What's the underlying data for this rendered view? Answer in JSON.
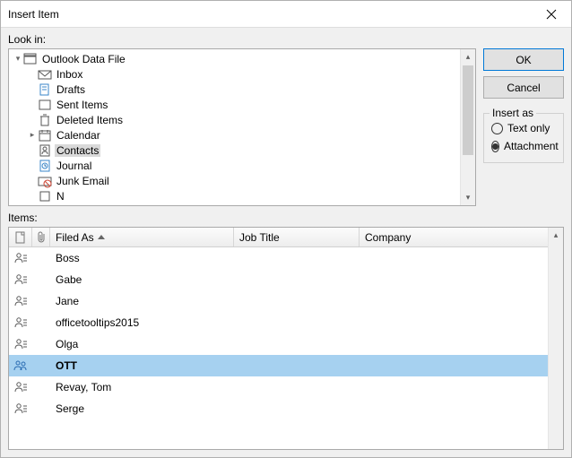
{
  "window_title": "Insert Item",
  "look_in_label": "Look in:",
  "items_label": "Items:",
  "buttons": {
    "ok": "OK",
    "cancel": "Cancel"
  },
  "insert_as": {
    "legend": "Insert as",
    "text_only": "Text only",
    "attachment": "Attachment",
    "selected": "attachment"
  },
  "tree": {
    "root": "Outlook Data File",
    "children": [
      "Inbox",
      "Drafts",
      "Sent Items",
      "Deleted Items",
      "Calendar",
      "Contacts",
      "Journal",
      "Junk Email",
      "Notes"
    ],
    "selected": "Contacts"
  },
  "columns": {
    "filed_as": "Filed As",
    "job_title": "Job Title",
    "company": "Company"
  },
  "items": [
    {
      "filed_as": "Boss",
      "job_title": "",
      "company": "",
      "type": "contact"
    },
    {
      "filed_as": "Gabe",
      "job_title": "",
      "company": "",
      "type": "contact"
    },
    {
      "filed_as": "Jane",
      "job_title": "",
      "company": "",
      "type": "contact"
    },
    {
      "filed_as": "officetooltips2015",
      "job_title": "",
      "company": "",
      "type": "contact"
    },
    {
      "filed_as": "Olga",
      "job_title": "",
      "company": "",
      "type": "contact"
    },
    {
      "filed_as": "OTT",
      "job_title": "",
      "company": "",
      "type": "group",
      "selected": true
    },
    {
      "filed_as": "Revay, Tom",
      "job_title": "",
      "company": "",
      "type": "contact"
    },
    {
      "filed_as": "Serge",
      "job_title": "",
      "company": "",
      "type": "contact"
    }
  ]
}
